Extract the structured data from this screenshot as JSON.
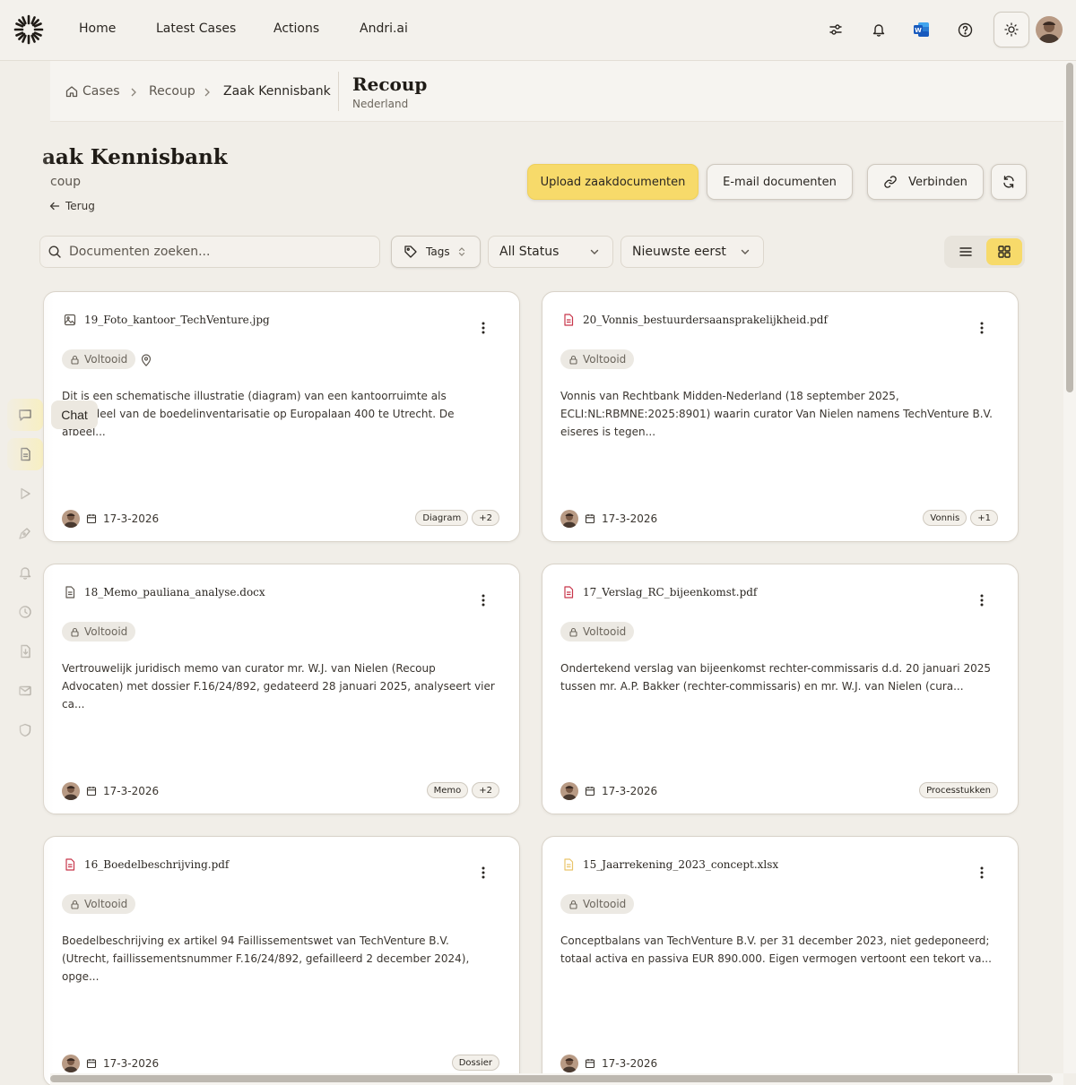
{
  "nav": {
    "items": [
      {
        "label": "Home"
      },
      {
        "label": "Latest Cases"
      },
      {
        "label": "Actions"
      },
      {
        "label": "Andri.ai"
      }
    ],
    "icons": [
      "sliders-icon",
      "bell-icon",
      "word-icon",
      "help-icon",
      "sun-icon",
      "avatar"
    ]
  },
  "sidebar": {
    "tooltip": "Chat",
    "items": [
      "chat-icon",
      "document-icon",
      "play-icon",
      "pen-icon",
      "bell-icon",
      "clock-icon",
      "file-icon",
      "mail-icon",
      "shield-icon"
    ]
  },
  "breadcrumb": {
    "items": [
      "Cases",
      "Recoup",
      "Zaak Kennisbank"
    ],
    "case_title": "Recoup",
    "case_country": "Nederland"
  },
  "header": {
    "title": "aak Kennisbank",
    "subtitle": "coup",
    "back_label": "Terug",
    "upload_label": "Upload zaakdocumenten",
    "email_label": "E-mail documenten",
    "connect_label": "Verbinden"
  },
  "filters": {
    "search_placeholder": "Documenten zoeken...",
    "tags_label": "Tags",
    "status_value": "All Status",
    "sort_value": "Nieuwste eerst"
  },
  "colors": {
    "accent": "#f7da6a",
    "pdf_icon": "#c8364a",
    "xlsx_icon": "#e9c46a"
  },
  "documents": [
    {
      "filename": "19_Foto_kantoor_TechVenture.jpg",
      "icon": "image-icon",
      "status": "Voltooid",
      "has_location": true,
      "description": "Dit is een schematische illustratie (diagram) van een kantoorruimte als onderdeel van de boedelinventarisatie op Europalaan 400 te Utrecht. De afbeel...",
      "date": "17-3-2026",
      "tags": [
        "Diagram",
        "+2"
      ]
    },
    {
      "filename": "20_Vonnis_bestuurdersaansprakelijkheid.pdf",
      "icon": "pdf-icon",
      "status": "Voltooid",
      "description": "Vonnis van Rechtbank Midden-Nederland (18 september 2025, ECLI:NL:RBMNE:2025:8901) waarin curator Van Nielen namens TechVenture B.V. eiseres is tegen...",
      "date": "17-3-2026",
      "tags": [
        "Vonnis",
        "+1"
      ]
    },
    {
      "filename": "18_Memo_pauliana_analyse.docx",
      "icon": "doc-icon",
      "status": "Voltooid",
      "description": "Vertrouwelijk juridisch memo van curator mr. W.J. van Nielen (Recoup Advocaten) met dossier F.16/24/892, gedateerd 28 januari 2025, analyseert vier ca...",
      "date": "17-3-2026",
      "tags": [
        "Memo",
        "+2"
      ]
    },
    {
      "filename": "17_Verslag_RC_bijeenkomst.pdf",
      "icon": "pdf-icon",
      "status": "Voltooid",
      "description": "Ondertekend verslag van bijeenkomst rechter-commissaris d.d. 20 januari 2025 tussen mr. A.P. Bakker (rechter-commissaris) en mr. W.J. van Nielen (cura...",
      "date": "17-3-2026",
      "tags": [
        "Processtukken"
      ]
    },
    {
      "filename": "16_Boedelbeschrijving.pdf",
      "icon": "pdf-icon",
      "status": "Voltooid",
      "description": "Boedelbeschrijving ex artikel 94 Faillissementswet van TechVenture B.V. (Utrecht, faillissementsnummer F.16/24/892, gefailleerd 2 december 2024), opge...",
      "date": "17-3-2026",
      "tags": [
        "Dossier"
      ]
    },
    {
      "filename": "15_Jaarrekening_2023_concept.xlsx",
      "icon": "xlsx-icon",
      "status": "Voltooid",
      "description": "Conceptbalans van TechVenture B.V. per 31 december 2023, niet gedeponeerd; totaal activa en passiva EUR 890.000. Eigen vermogen vertoont een tekort va...",
      "date": "17-3-2026",
      "tags": []
    }
  ]
}
